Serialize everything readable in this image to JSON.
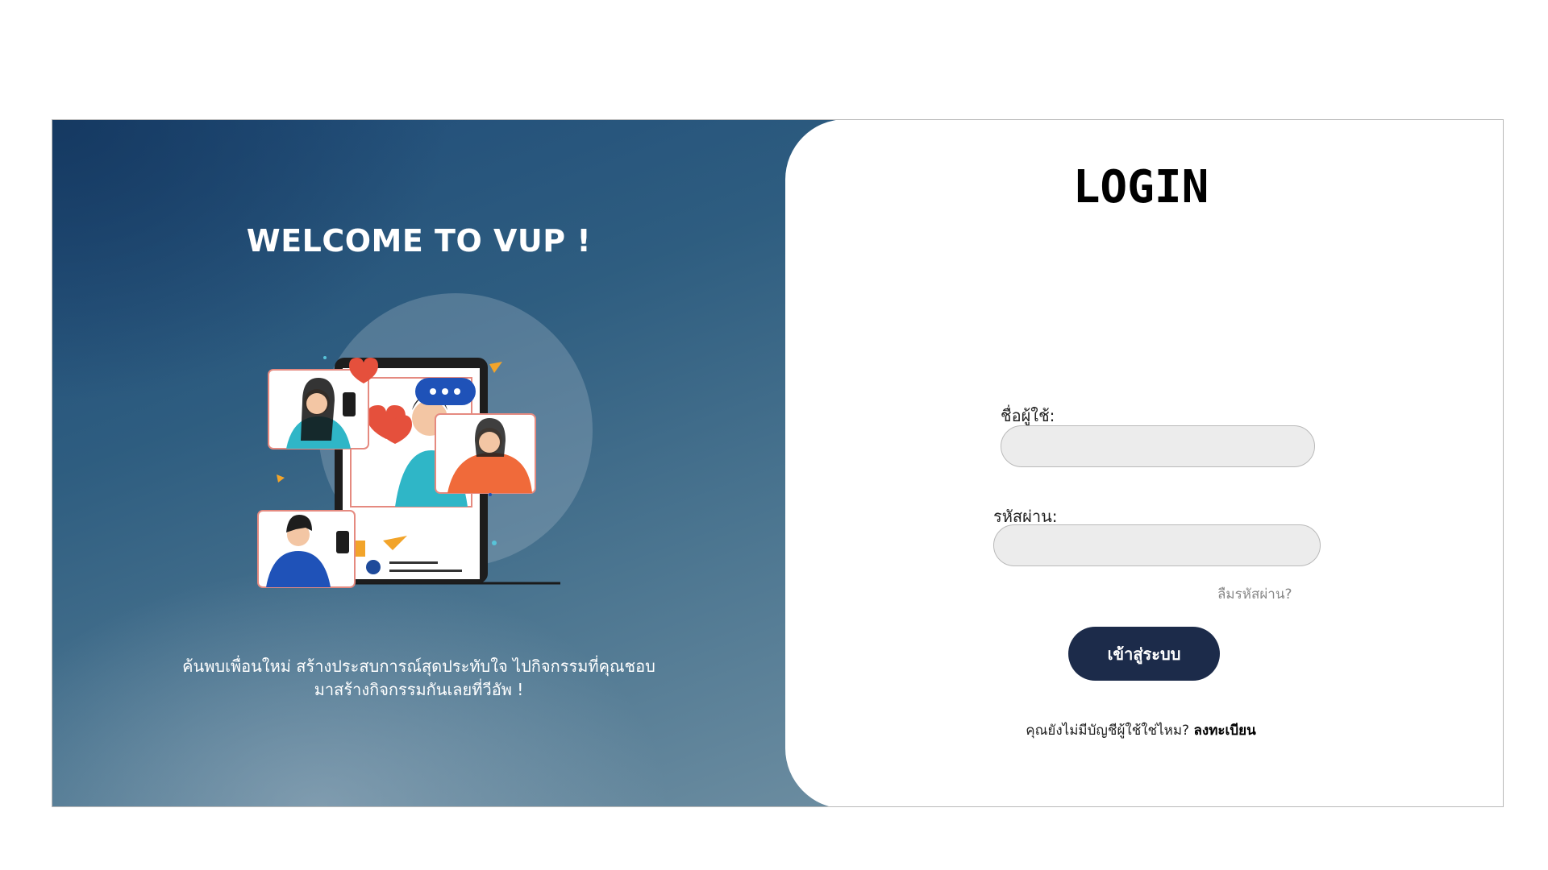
{
  "hero": {
    "title": "WELCOME TO VUP !",
    "subtitle_line1": "ค้นพบเพื่อนใหม่ สร้างประสบการณ์สุดประทับใจ ไปกิจกรรมที่คุณชอบ",
    "subtitle_line2": "มาสร้างกิจกรรมกันเลยที่วีอัพ !",
    "illustration": "social-people-phones-illustration"
  },
  "login": {
    "title": "LOGIN",
    "username_label": "ชื่อผู้ใช้:",
    "username_value": "",
    "password_label": "รหัสผ่าน:",
    "password_value": "",
    "forgot_label": "ลืมรหัสผ่าน?",
    "submit_label": "เข้าสู่ระบบ",
    "register_prompt": "คุณยังไม่มีบัญชีผู้ใช้ใช่ไหม?",
    "register_link": "ลงทะเบียน"
  },
  "colors": {
    "button_bg": "#1c2b4a",
    "hero_dark": "#1f4b78",
    "hero_light": "#6f8fa2",
    "field_bg": "#ececec"
  }
}
